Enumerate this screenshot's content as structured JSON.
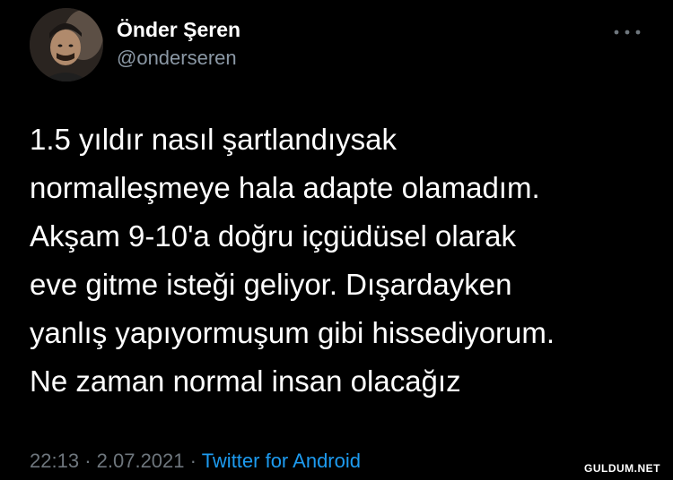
{
  "user": {
    "display_name": "Önder Şeren",
    "handle": "@onderseren",
    "avatar_icon": "user-avatar"
  },
  "tweet": {
    "lines": [
      "1.5 yıldır nasıl şartlandıysak",
      "normalleşmeye hala adapte olamadım.",
      "Akşam 9-10'a doğru içgüdüsel olarak",
      "eve gitme isteği geliyor. Dışardayken",
      "yanlış yapıyormuşum gibi hissediyorum.",
      "Ne zaman normal insan olacağız"
    ]
  },
  "meta": {
    "time": "22:13",
    "separator": "·",
    "date": "2.07.2021",
    "source": "Twitter for Android"
  },
  "more_icon": "more-horizontal-icon",
  "watermark": "GULDUM.NET",
  "colors": {
    "background": "#000000",
    "text": "#ffffff",
    "secondary": "#6e767d",
    "link": "#1d9bf0"
  }
}
